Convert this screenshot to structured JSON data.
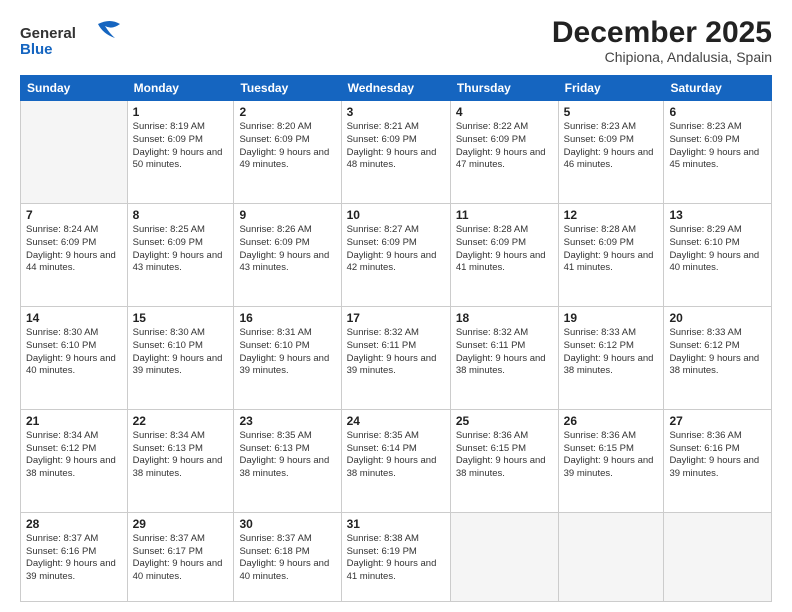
{
  "header": {
    "logo_general": "General",
    "logo_blue": "Blue",
    "month_title": "December 2025",
    "subtitle": "Chipiona, Andalusia, Spain"
  },
  "weekdays": [
    "Sunday",
    "Monday",
    "Tuesday",
    "Wednesday",
    "Thursday",
    "Friday",
    "Saturday"
  ],
  "weeks": [
    [
      {
        "day": "",
        "empty": true
      },
      {
        "day": "1",
        "sunrise": "Sunrise: 8:19 AM",
        "sunset": "Sunset: 6:09 PM",
        "daylight": "Daylight: 9 hours and 50 minutes."
      },
      {
        "day": "2",
        "sunrise": "Sunrise: 8:20 AM",
        "sunset": "Sunset: 6:09 PM",
        "daylight": "Daylight: 9 hours and 49 minutes."
      },
      {
        "day": "3",
        "sunrise": "Sunrise: 8:21 AM",
        "sunset": "Sunset: 6:09 PM",
        "daylight": "Daylight: 9 hours and 48 minutes."
      },
      {
        "day": "4",
        "sunrise": "Sunrise: 8:22 AM",
        "sunset": "Sunset: 6:09 PM",
        "daylight": "Daylight: 9 hours and 47 minutes."
      },
      {
        "day": "5",
        "sunrise": "Sunrise: 8:23 AM",
        "sunset": "Sunset: 6:09 PM",
        "daylight": "Daylight: 9 hours and 46 minutes."
      },
      {
        "day": "6",
        "sunrise": "Sunrise: 8:23 AM",
        "sunset": "Sunset: 6:09 PM",
        "daylight": "Daylight: 9 hours and 45 minutes."
      }
    ],
    [
      {
        "day": "7",
        "sunrise": "Sunrise: 8:24 AM",
        "sunset": "Sunset: 6:09 PM",
        "daylight": "Daylight: 9 hours and 44 minutes."
      },
      {
        "day": "8",
        "sunrise": "Sunrise: 8:25 AM",
        "sunset": "Sunset: 6:09 PM",
        "daylight": "Daylight: 9 hours and 43 minutes."
      },
      {
        "day": "9",
        "sunrise": "Sunrise: 8:26 AM",
        "sunset": "Sunset: 6:09 PM",
        "daylight": "Daylight: 9 hours and 43 minutes."
      },
      {
        "day": "10",
        "sunrise": "Sunrise: 8:27 AM",
        "sunset": "Sunset: 6:09 PM",
        "daylight": "Daylight: 9 hours and 42 minutes."
      },
      {
        "day": "11",
        "sunrise": "Sunrise: 8:28 AM",
        "sunset": "Sunset: 6:09 PM",
        "daylight": "Daylight: 9 hours and 41 minutes."
      },
      {
        "day": "12",
        "sunrise": "Sunrise: 8:28 AM",
        "sunset": "Sunset: 6:09 PM",
        "daylight": "Daylight: 9 hours and 41 minutes."
      },
      {
        "day": "13",
        "sunrise": "Sunrise: 8:29 AM",
        "sunset": "Sunset: 6:10 PM",
        "daylight": "Daylight: 9 hours and 40 minutes."
      }
    ],
    [
      {
        "day": "14",
        "sunrise": "Sunrise: 8:30 AM",
        "sunset": "Sunset: 6:10 PM",
        "daylight": "Daylight: 9 hours and 40 minutes."
      },
      {
        "day": "15",
        "sunrise": "Sunrise: 8:30 AM",
        "sunset": "Sunset: 6:10 PM",
        "daylight": "Daylight: 9 hours and 39 minutes."
      },
      {
        "day": "16",
        "sunrise": "Sunrise: 8:31 AM",
        "sunset": "Sunset: 6:10 PM",
        "daylight": "Daylight: 9 hours and 39 minutes."
      },
      {
        "day": "17",
        "sunrise": "Sunrise: 8:32 AM",
        "sunset": "Sunset: 6:11 PM",
        "daylight": "Daylight: 9 hours and 39 minutes."
      },
      {
        "day": "18",
        "sunrise": "Sunrise: 8:32 AM",
        "sunset": "Sunset: 6:11 PM",
        "daylight": "Daylight: 9 hours and 38 minutes."
      },
      {
        "day": "19",
        "sunrise": "Sunrise: 8:33 AM",
        "sunset": "Sunset: 6:12 PM",
        "daylight": "Daylight: 9 hours and 38 minutes."
      },
      {
        "day": "20",
        "sunrise": "Sunrise: 8:33 AM",
        "sunset": "Sunset: 6:12 PM",
        "daylight": "Daylight: 9 hours and 38 minutes."
      }
    ],
    [
      {
        "day": "21",
        "sunrise": "Sunrise: 8:34 AM",
        "sunset": "Sunset: 6:12 PM",
        "daylight": "Daylight: 9 hours and 38 minutes."
      },
      {
        "day": "22",
        "sunrise": "Sunrise: 8:34 AM",
        "sunset": "Sunset: 6:13 PM",
        "daylight": "Daylight: 9 hours and 38 minutes."
      },
      {
        "day": "23",
        "sunrise": "Sunrise: 8:35 AM",
        "sunset": "Sunset: 6:13 PM",
        "daylight": "Daylight: 9 hours and 38 minutes."
      },
      {
        "day": "24",
        "sunrise": "Sunrise: 8:35 AM",
        "sunset": "Sunset: 6:14 PM",
        "daylight": "Daylight: 9 hours and 38 minutes."
      },
      {
        "day": "25",
        "sunrise": "Sunrise: 8:36 AM",
        "sunset": "Sunset: 6:15 PM",
        "daylight": "Daylight: 9 hours and 38 minutes."
      },
      {
        "day": "26",
        "sunrise": "Sunrise: 8:36 AM",
        "sunset": "Sunset: 6:15 PM",
        "daylight": "Daylight: 9 hours and 39 minutes."
      },
      {
        "day": "27",
        "sunrise": "Sunrise: 8:36 AM",
        "sunset": "Sunset: 6:16 PM",
        "daylight": "Daylight: 9 hours and 39 minutes."
      }
    ],
    [
      {
        "day": "28",
        "sunrise": "Sunrise: 8:37 AM",
        "sunset": "Sunset: 6:16 PM",
        "daylight": "Daylight: 9 hours and 39 minutes."
      },
      {
        "day": "29",
        "sunrise": "Sunrise: 8:37 AM",
        "sunset": "Sunset: 6:17 PM",
        "daylight": "Daylight: 9 hours and 40 minutes."
      },
      {
        "day": "30",
        "sunrise": "Sunrise: 8:37 AM",
        "sunset": "Sunset: 6:18 PM",
        "daylight": "Daylight: 9 hours and 40 minutes."
      },
      {
        "day": "31",
        "sunrise": "Sunrise: 8:38 AM",
        "sunset": "Sunset: 6:19 PM",
        "daylight": "Daylight: 9 hours and 41 minutes."
      },
      {
        "day": "",
        "empty": true
      },
      {
        "day": "",
        "empty": true
      },
      {
        "day": "",
        "empty": true
      }
    ]
  ]
}
